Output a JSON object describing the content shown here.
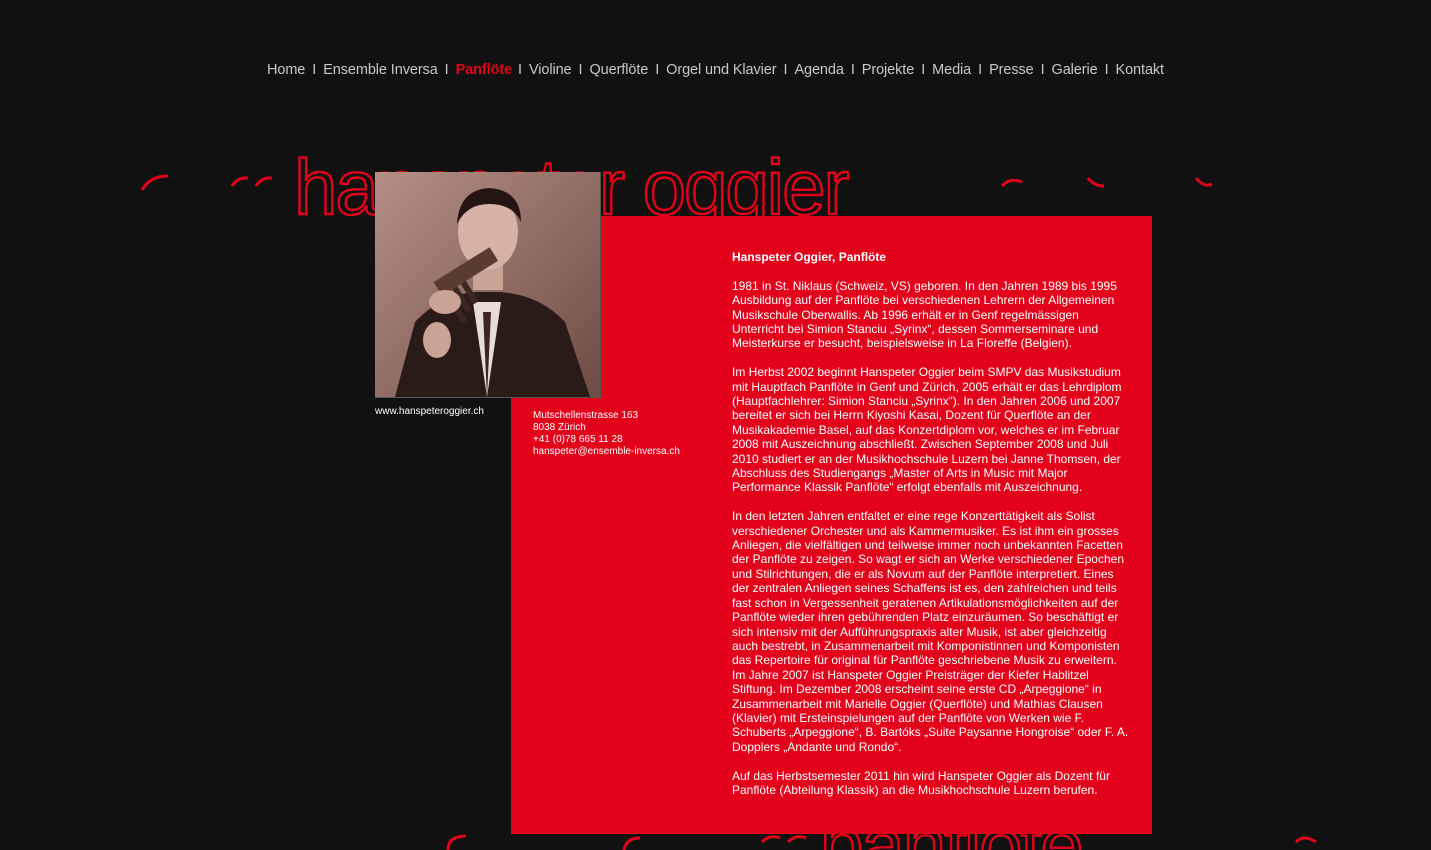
{
  "nav": {
    "items": [
      {
        "label": "Home"
      },
      {
        "label": "Ensemble Inversa"
      },
      {
        "label": "Panflöte",
        "active": true
      },
      {
        "label": "Violine"
      },
      {
        "label": "Querflöte"
      },
      {
        "label": "Orgel und Klavier"
      },
      {
        "label": "Agenda"
      },
      {
        "label": "Projekte"
      },
      {
        "label": "Media"
      },
      {
        "label": "Presse"
      },
      {
        "label": "Galerie"
      },
      {
        "label": "Kontakt"
      }
    ],
    "separator": "I"
  },
  "banner": {
    "name": "hanspeter oggier",
    "instrument": "panflöte"
  },
  "colors": {
    "accent": "#e3001b",
    "background": "#111111",
    "nav_text": "#c8c8c8"
  },
  "profile": {
    "photo_icon": "musician-photo",
    "website": "www.hanspeteroggier.ch"
  },
  "contact": {
    "street": "Mutschellenstrasse 163",
    "city": "8038 Zürich",
    "phone": "+41 (0)78 665 11 28",
    "email": "hanspeter@ensemble-inversa.ch"
  },
  "bio": {
    "heading": "Hanspeter Oggier, Panflöte",
    "paragraphs": [
      "1981 in St. Niklaus (Schweiz, VS) geboren. In den Jahren 1989 bis 1995 Ausbildung auf der Panflöte bei verschiedenen Lehrern der Allgemeinen Musikschule Oberwallis. Ab 1996 erhält er in Genf regelmässigen Unterricht bei Simion Stanciu „Syrinx“, dessen Sommerseminare und Meisterkurse er besucht, beispielsweise in La Floreffe (Belgien).",
      "Im Herbst 2002 beginnt Hanspeter Oggier beim SMPV das Musikstudium mit Hauptfach Panflöte in Genf und Zürich, 2005 erhält er das Lehrdiplom (Hauptfachlehrer: Simion Stanciu „Syrinx“). In den Jahren 2006 und 2007 bereitet er sich bei Herrn Kiyoshi Kasai, Dozent für Querflöte an der Musikakademie Basel, auf das Konzertdiplom vor, welches er im Februar 2008 mit Auszeichnung abschließt. Zwischen September 2008 und Juli 2010 studiert er an der Musikhochschule Luzern bei Janne Thomsen, der Abschluss des Studiengangs „Master of Arts in Music mit Major Performance Klassik Panflöte“ erfolgt ebenfalls mit Auszeichnung.",
      "In den letzten Jahren entfaltet er eine rege Konzerttätigkeit als Solist verschiedener Orchester und als Kammermusiker. Es ist ihm ein grosses Anliegen, die vielfältigen und teilweise immer noch unbekannten Facetten der Panflöte  zu zeigen. So wagt er sich an Werke verschiedener Epochen und Stilrichtungen, die er als Novum auf der Panflöte interpretiert.  Eines der zentralen Anliegen seines Schaffens ist es, den zahlreichen und teils fast schon in Vergessenheit geratenen Artikulationsmöglichkeiten auf der Panflöte wieder ihren gebührenden Platz einzuräumen. So beschäftigt er sich intensiv mit der Aufführungspraxis alter Musik, ist aber gleichzeitig auch bestrebt, in Zusammenarbeit mit Komponistinnen und Komponisten das Repertoire für original für Panflöte geschriebene Musik zu erweitern. Im Jahre 2007 ist Hanspeter Oggier Preisträger der Kiefer Hablitzel Stiftung. Im Dezember 2008 erscheint seine erste CD „Arpeggione“ in Zusammenarbeit mit Marielle Oggier (Querflöte) und Mathias Clausen (Klavier) mit Ersteinspielungen auf der Panflöte von Werken wie F. Schuberts „Arpeggione“, B. Bartóks „Suite Paysanne Hongroise“ oder F. A. Dopplers „Andante und Rondo“.",
      "Auf das Herbstsemester 2011 hin wird Hanspeter Oggier als Dozent für Panflöte (Abteilung Klassik) an die Musikhochschule Luzern berufen."
    ]
  }
}
